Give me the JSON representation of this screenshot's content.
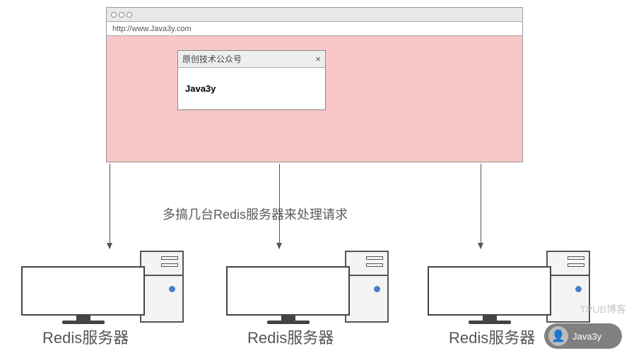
{
  "browser": {
    "url": "http://www.Java3y.com",
    "dialog": {
      "title": "原创技术公众号",
      "close": "×",
      "body": "Java3y"
    }
  },
  "caption": "多搞几台Redis服务器来处理请求",
  "servers": [
    {
      "label": "Redis服务器"
    },
    {
      "label": "Redis服务器"
    },
    {
      "label": "Redis服务器"
    }
  ],
  "watermark": {
    "blog": "TPUB博客",
    "account": "Java3y"
  }
}
